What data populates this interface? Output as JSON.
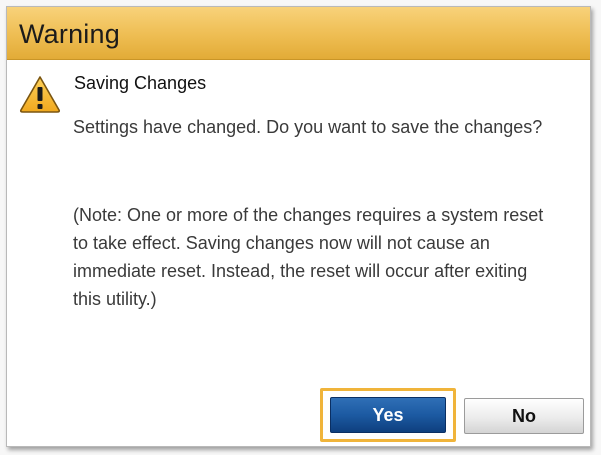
{
  "dialog": {
    "title": "Warning",
    "icon": "warning-triangle-icon",
    "heading": "Saving Changes",
    "message": "Settings have changed. Do you want to save the changes?",
    "note": "(Note: One or more of the changes requires a system reset to take effect. Saving changes now will not cause an immediate reset. Instead, the reset will occur after exiting this utility.)",
    "buttons": {
      "yes_label": "Yes",
      "no_label": "No"
    }
  },
  "colors": {
    "title_bar": "#eebd52",
    "focus_outline": "#f0b43a",
    "primary_button": "#1c5aa2"
  }
}
